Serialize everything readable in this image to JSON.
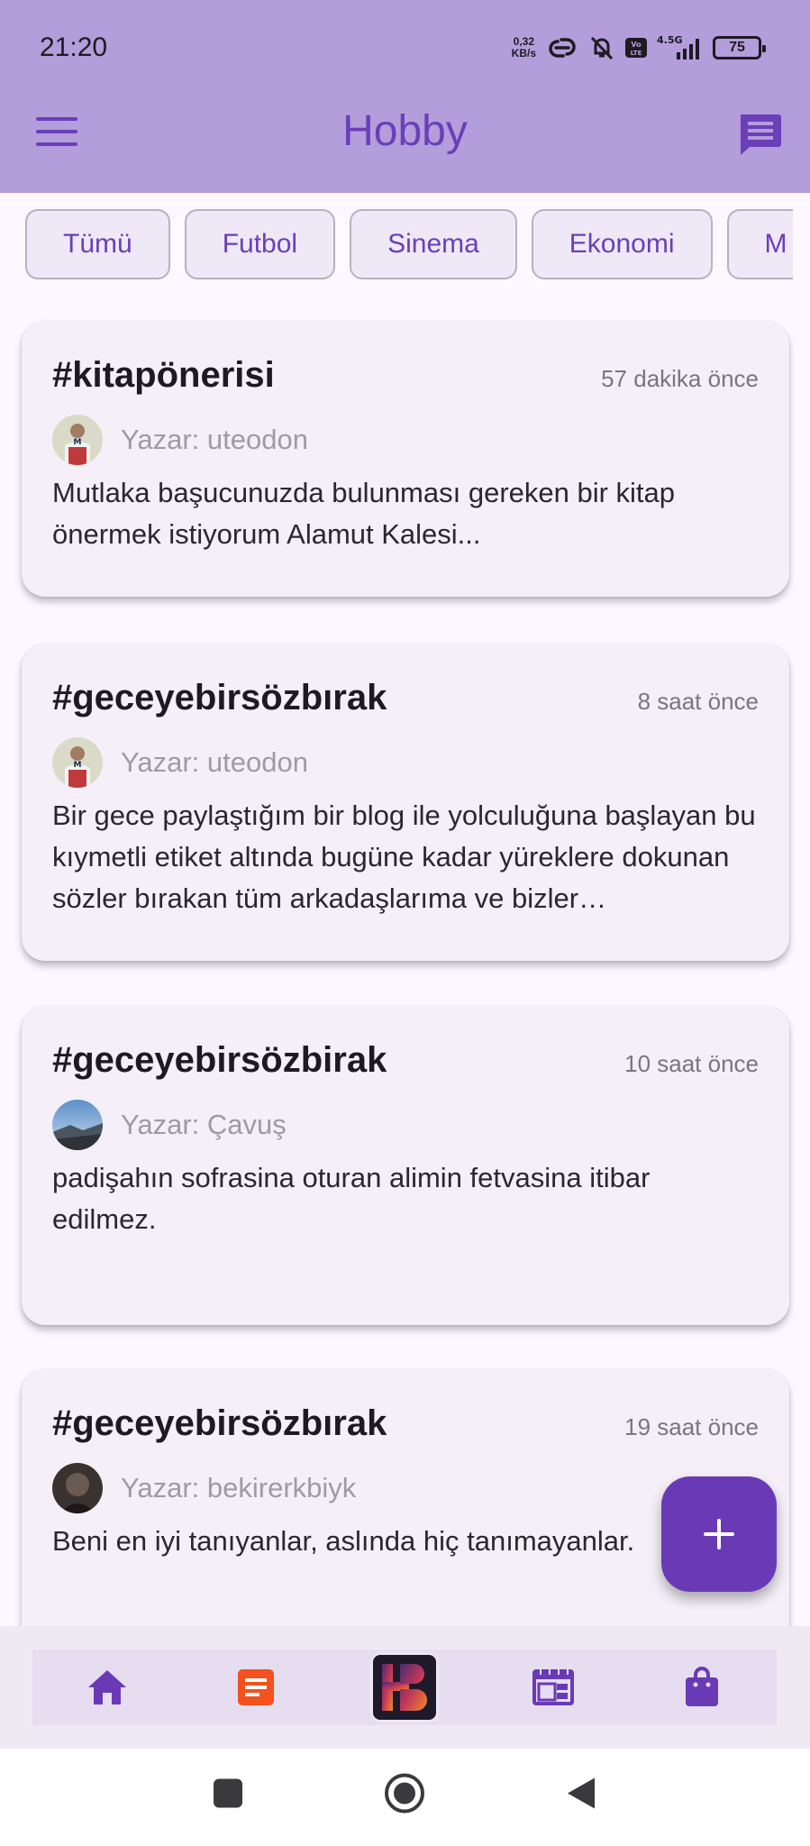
{
  "status_bar": {
    "time": "21:20",
    "net_speed_value": "0,32",
    "net_speed_unit": "KB/s",
    "network_type": "4.5G",
    "volte": "Vo LTE",
    "battery": "75"
  },
  "app_bar": {
    "title": "Hobby",
    "menu_icon": "hamburger-menu-icon",
    "chat_icon": "chat-bubble-icon"
  },
  "categories": [
    "Tümü",
    "Futbol",
    "Sinema",
    "Ekonomi",
    "M"
  ],
  "posts": [
    {
      "tag": "#kitapönerisi",
      "time": "57 dakika önce",
      "author": "Yazar: uteodon",
      "body": "Mutlaka başucunuzda bulunması gereken bir kitap önermek istiyorum Alamut Kalesi..."
    },
    {
      "tag": "#geceyebirsözbırak",
      "time": "8 saat önce",
      "author": "Yazar: uteodon",
      "body": "Bir gece paylaştığım bir blog ile yolculuğuna başlayan bu kıymetli etiket altında bugüne kadar yüreklere dokunan sözler bırakan tüm arkadaşlarıma ve bizler…"
    },
    {
      "tag": "#geceyebirsözbirak",
      "time": "10 saat önce",
      "author": "Yazar: Çavuş",
      "body": "padişahın sofrasina oturan alimin fetvasina itibar edilmez."
    },
    {
      "tag": "#geceyebirsözbırak",
      "time": "19 saat önce",
      "author": "Yazar: bekirerkbiyk",
      "body": "Beni en iyi tanıyanlar, aslında hiç tanımayanlar."
    }
  ],
  "fab": {
    "icon": "plus-icon"
  },
  "bottom_nav": {
    "items": [
      "home-icon",
      "article-icon",
      "hb-logo",
      "calendar-icon",
      "shopping-bag-icon"
    ]
  },
  "system_nav": [
    "recents-square-icon",
    "home-circle-icon",
    "back-triangle-icon"
  ],
  "colors": {
    "app_bar": "#b39ddb",
    "accent": "#6a3fb8",
    "fab": "#6a3ab6",
    "article_icon": "#f4511e",
    "background": "#fdf7ff",
    "card": "#f5eff8"
  }
}
